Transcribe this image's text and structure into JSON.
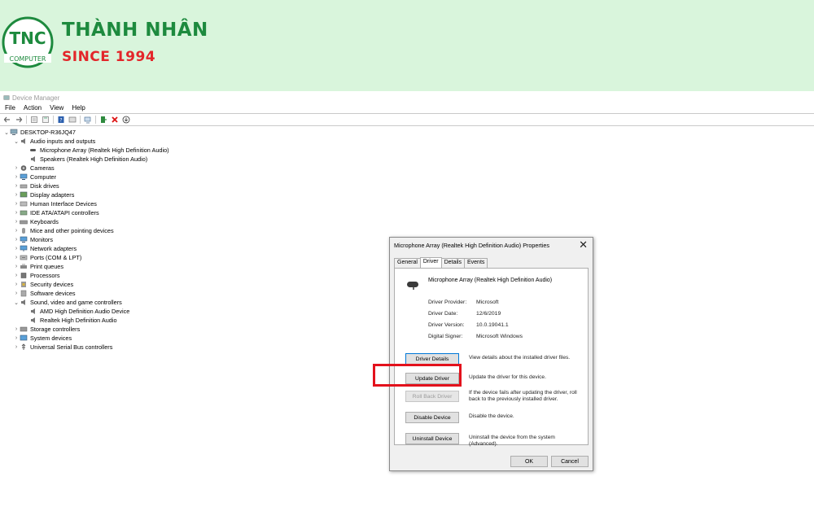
{
  "banner": {
    "logo_text": "TNC",
    "logo_sub": "COMPUTER",
    "brand_name": "THÀNH NHÂN",
    "since": "SINCE 1994",
    "colors": {
      "green": "#1d8a3e",
      "red": "#e3262a",
      "background": "#d9f5dc"
    }
  },
  "window": {
    "title": "Device Manager",
    "menu": [
      "File",
      "Action",
      "View",
      "Help"
    ]
  },
  "tree": {
    "root": "DESKTOP-R36JQ47",
    "nodes": [
      "Audio inputs and outputs",
      "Microphone Array (Realtek High Definition Audio)",
      "Speakers (Realtek High Definition Audio)",
      "Cameras",
      "Computer",
      "Disk drives",
      "Display adapters",
      "Human Interface Devices",
      "IDE ATA/ATAPI controllers",
      "Keyboards",
      "Mice and other pointing devices",
      "Monitors",
      "Network adapters",
      "Ports (COM & LPT)",
      "Print queues",
      "Processors",
      "Security devices",
      "Software devices",
      "Sound, video and game controllers",
      "AMD High Definition Audio Device",
      "Realtek High Definition Audio",
      "Storage controllers",
      "System devices",
      "Universal Serial Bus controllers"
    ]
  },
  "dialog": {
    "title": "Microphone Array (Realtek High Definition Audio) Properties",
    "tabs": [
      "General",
      "Driver",
      "Details",
      "Events"
    ],
    "active_tab": "Driver",
    "device_name": "Microphone Array (Realtek High Definition Audio)",
    "props": [
      {
        "label": "Driver Provider:",
        "value": "Microsoft"
      },
      {
        "label": "Driver Date:",
        "value": "12/6/2019"
      },
      {
        "label": "Driver Version:",
        "value": "10.0.19041.1"
      },
      {
        "label": "Digital Signer:",
        "value": "Microsoft Windows"
      }
    ],
    "actions": [
      {
        "button": "Driver Details",
        "desc": "View details about the installed driver files."
      },
      {
        "button": "Update Driver",
        "desc": "Update the driver for this device."
      },
      {
        "button": "Roll Back Driver",
        "desc": "If the device fails after updating the driver, roll back to the previously installed driver."
      },
      {
        "button": "Disable Device",
        "desc": "Disable the device."
      },
      {
        "button": "Uninstall Device",
        "desc": "Uninstall the device from the system (Advanced)."
      }
    ],
    "ok": "OK",
    "cancel": "Cancel"
  }
}
